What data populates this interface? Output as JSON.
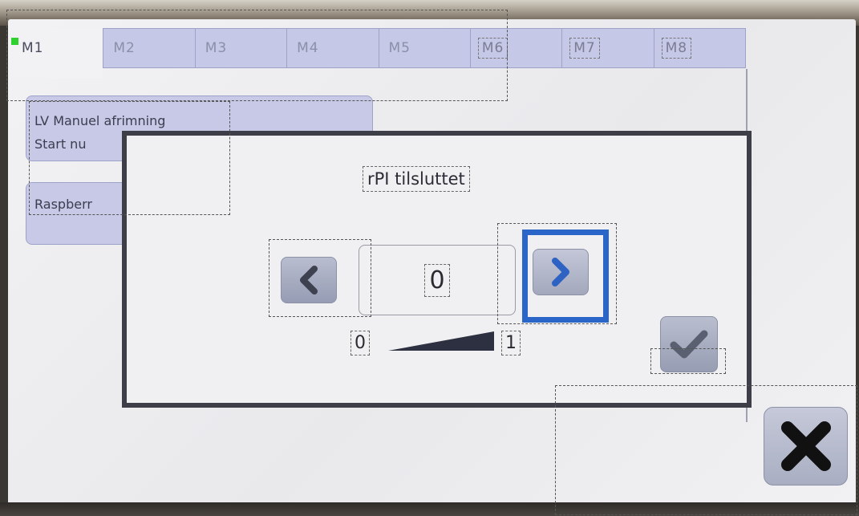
{
  "tabs": [
    {
      "label": "M1",
      "active": true
    },
    {
      "label": "M2"
    },
    {
      "label": "M3"
    },
    {
      "label": "M4"
    },
    {
      "label": "M5"
    },
    {
      "label": "M6"
    },
    {
      "label": "M7"
    },
    {
      "label": "M8"
    }
  ],
  "menu": {
    "button1_line1": "LV Manuel afrimning",
    "button1_line2": "Start nu",
    "button2_label": "Raspberr"
  },
  "dialog": {
    "title": "rPI tilsluttet",
    "value": "0",
    "range_min": "0",
    "range_max": "1",
    "prev_icon": "chevron-left-icon",
    "next_icon": "chevron-right-icon",
    "confirm_icon": "checkmark-icon"
  },
  "close_icon": "close-x-icon",
  "colors": {
    "tab_bg": "#c5c8e6",
    "button_bg": "#c7c9e6",
    "focus_blue": "#2a66c7",
    "indicator_green": "#2fd12f"
  }
}
